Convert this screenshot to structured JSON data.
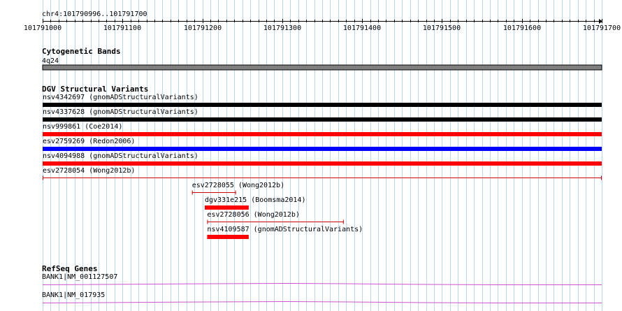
{
  "header": {
    "location": "chr4:101790996..101791700"
  },
  "ruler": {
    "start": 101791000,
    "end": 101791700,
    "tick_labels": [
      "101791000",
      "101791100",
      "101791200",
      "101791300",
      "101791400",
      "101791500",
      "101791600",
      "101791700"
    ]
  },
  "colors": {
    "gridline": "#b9d7f0",
    "black": "#000000",
    "red": "#ff0000",
    "blue": "#0000ff",
    "gray": "#808080",
    "gene": "#cc55cc",
    "darkred": "#cc0000"
  },
  "tracks": {
    "cytoband": {
      "title": "Cytogenetic Bands",
      "band_label": "4q24"
    },
    "dgv": {
      "title": "DGV Structural Variants",
      "features": [
        {
          "label": "nsv4342697 (gnomADStructuralVariants)",
          "start": 101790996,
          "end": 101791700,
          "color": "black",
          "style": "bar"
        },
        {
          "label": "nsv4337628 (gnomADStructuralVariants)",
          "start": 101790996,
          "end": 101791700,
          "color": "black",
          "style": "bar"
        },
        {
          "label": "nsv999861 (Coe2014)",
          "start": 101790996,
          "end": 101791700,
          "color": "red",
          "style": "bar"
        },
        {
          "label": "esv2759269 (Redon2006)",
          "start": 101790996,
          "end": 101791700,
          "color": "blue",
          "style": "bar"
        },
        {
          "label": "nsv4094988 (gnomADStructuralVariants)",
          "start": 101790996,
          "end": 101791700,
          "color": "red",
          "style": "bar"
        },
        {
          "label": "esv2728054 (Wong2012b)",
          "start": 101791000,
          "end": 101791700,
          "color": "darkred",
          "style": "line"
        },
        {
          "label": "esv2728055 (Wong2012b)",
          "start": 101791187,
          "end": 101791242,
          "color": "darkred",
          "style": "line"
        },
        {
          "label": "dgv331e215 (Boomsma2014)",
          "start": 101791203,
          "end": 101791258,
          "color": "red",
          "style": "bar"
        },
        {
          "label": "esv2728056 (Wong2012b)",
          "start": 101791206,
          "end": 101791377,
          "color": "darkred",
          "style": "line"
        },
        {
          "label": "nsv4109587 (gnomADStructuralVariants)",
          "start": 101791206,
          "end": 101791258,
          "color": "red",
          "style": "bar"
        }
      ]
    },
    "refseq": {
      "title": "RefSeq Genes",
      "genes": [
        {
          "label": "BANK1|NM_001127507"
        },
        {
          "label": "BANK1|NM_017935"
        }
      ]
    }
  }
}
